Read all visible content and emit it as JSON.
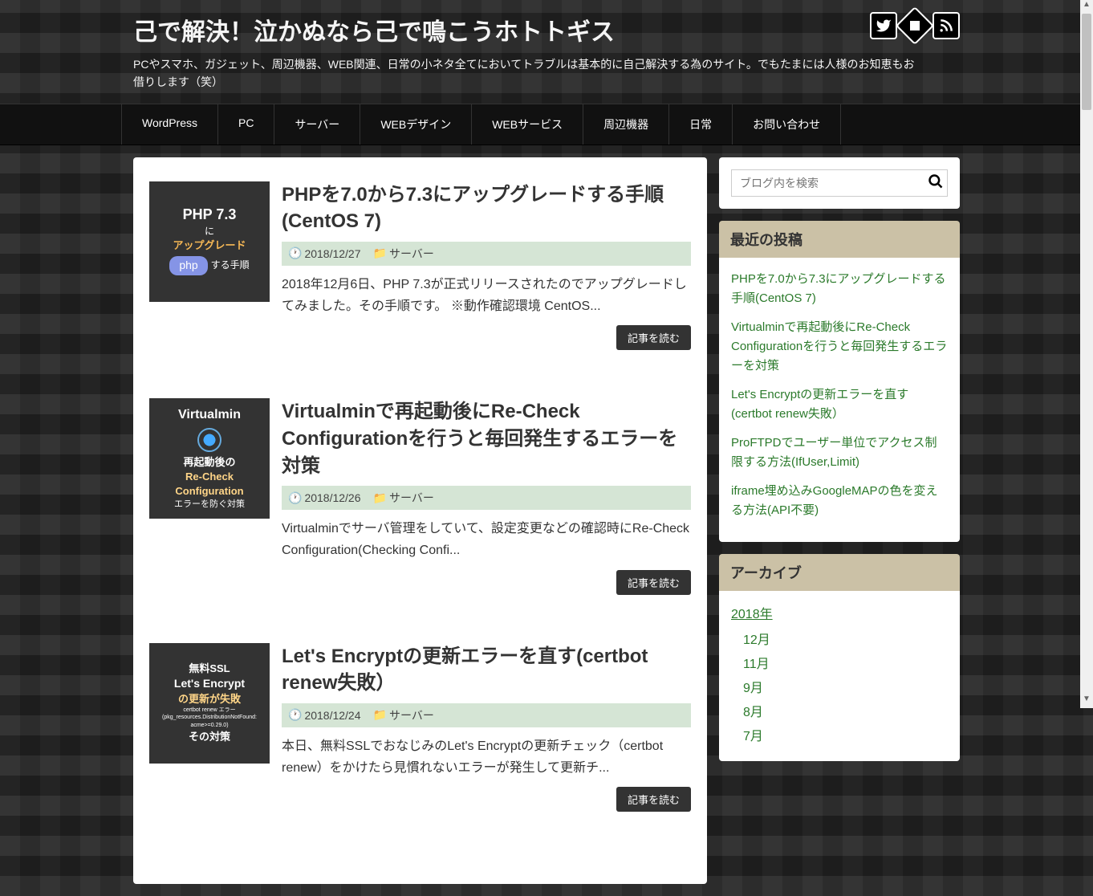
{
  "header": {
    "title": "己で解決！泣かぬなら己で鳴こうホトトギス",
    "description": "PCやスマホ、ガジェット、周辺機器、WEB関連、日常の小ネタ全てにおいてトラブルは基本的に自己解決する為のサイト。でもたまには人様のお知恵もお借りします（笑）"
  },
  "nav": [
    "WordPress",
    "PC",
    "サーバー",
    "WEBデザイン",
    "WEBサービス",
    "周辺機器",
    "日常",
    "お問い合わせ"
  ],
  "posts": [
    {
      "title": "PHPを7.0から7.3にアップグレードする手順(CentOS 7)",
      "date": "2018/12/27",
      "category": "サーバー",
      "excerpt": "2018年12月6日、PHP 7.3が正式リリースされたのでアップグレードしてみました。その手順です。 ※動作確認環境 CentOS...",
      "read_more": "記事を読む",
      "thumb": {
        "l1": "PHP 7.3",
        "l2": "に",
        "l3": "アップグレード",
        "l4": "php",
        "l5": "する手順"
      }
    },
    {
      "title": "Virtualminで再起動後にRe-Check Configurationを行うと毎回発生するエラーを対策",
      "date": "2018/12/26",
      "category": "サーバー",
      "excerpt": "Virtualminでサーバ管理をしていて、設定変更などの確認時にRe-Check Configuration(Checking Confi...",
      "read_more": "記事を読む",
      "thumb": {
        "l1": "Virtualmin",
        "l2": "再起動後の",
        "l3": "Re-Check",
        "l4": "Configuration",
        "l5": "エラーを防ぐ対策"
      }
    },
    {
      "title": "Let's Encryptの更新エラーを直す(certbot renew失敗）",
      "date": "2018/12/24",
      "category": "サーバー",
      "excerpt": "本日、無料SSLでおなじみのLet's Encryptの更新チェック（certbot renew）をかけたら見慣れないエラーが発生して更新チ...",
      "read_more": "記事を読む",
      "thumb": {
        "l1": "無料SSL",
        "l2": "Let's Encrypt",
        "l3": "の更新が失敗",
        "l4": "certbot renew エラー\n(pkg_resources.DistributionNotFound:\nacme>=0.29.0)",
        "l5": "その対策"
      }
    }
  ],
  "search": {
    "placeholder": "ブログ内を検索"
  },
  "sidebar": {
    "recent_title": "最近の投稿",
    "recent": [
      "PHPを7.0から7.3にアップグレードする手順(CentOS 7)",
      "Virtualminで再起動後にRe-Check Configurationを行うと毎回発生するエラーを対策",
      "Let's Encryptの更新エラーを直す(certbot renew失敗）",
      "ProFTPDでユーザー単位でアクセス制限する方法(IfUser,Limit)",
      "iframe埋め込みGoogleMAPの色を変える方法(API不要)"
    ],
    "archive_title": "アーカイブ",
    "archive_year": "2018年",
    "archive_months": [
      "12月",
      "11月",
      "9月",
      "8月",
      "7月"
    ]
  }
}
